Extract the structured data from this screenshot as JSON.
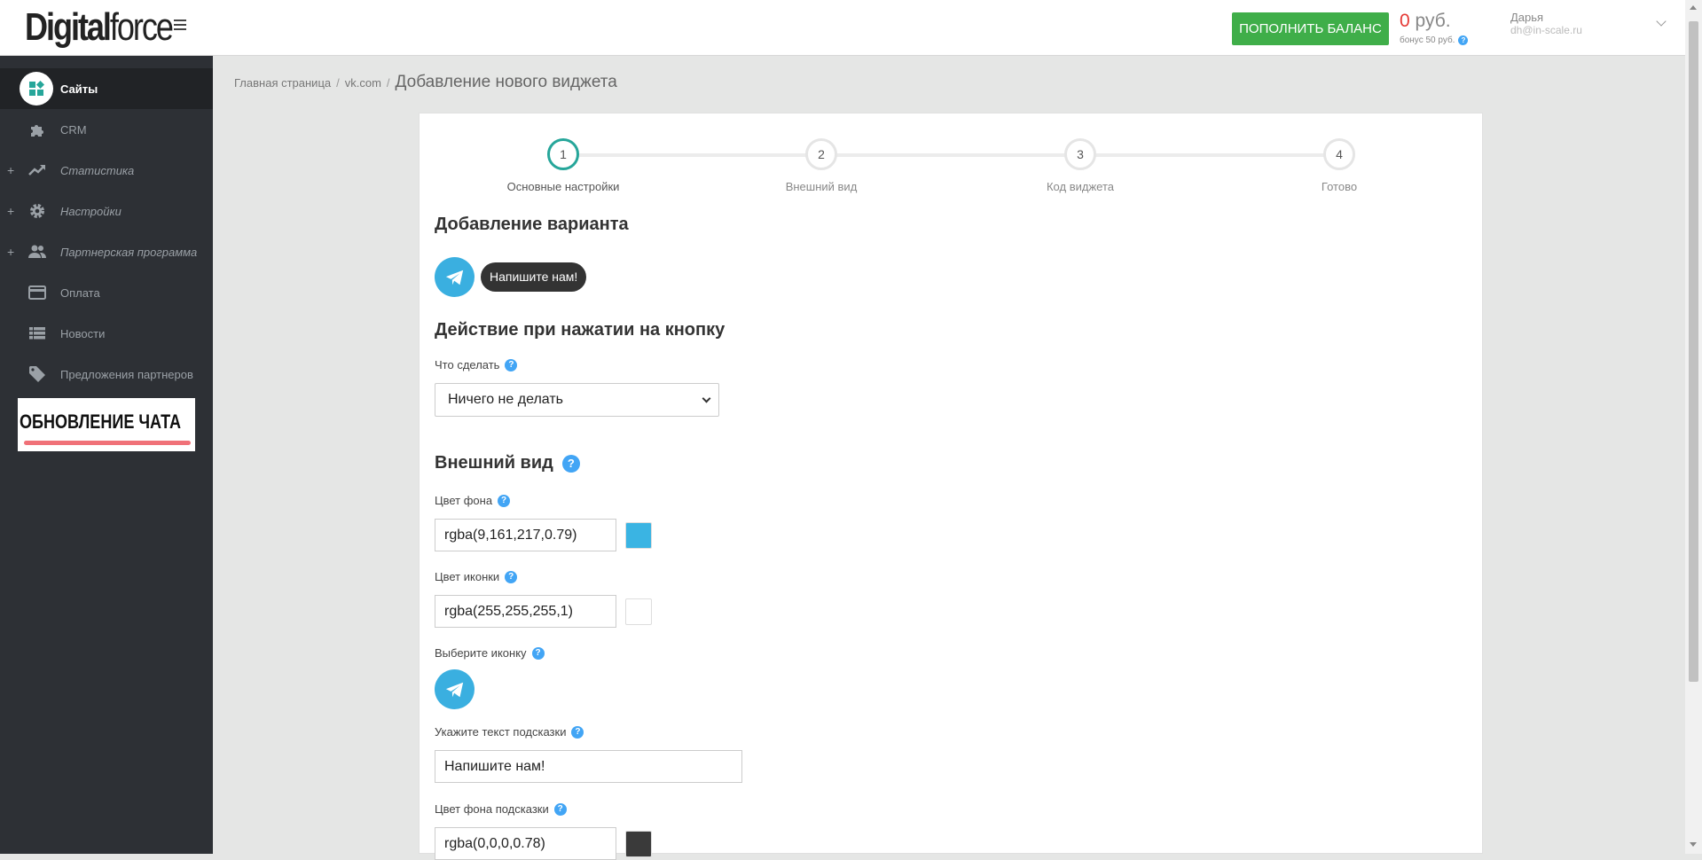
{
  "header": {
    "logo_bold": "Digital",
    "logo_rest": "force",
    "topup_label": "ПОПОЛНИТЬ БАЛАНС",
    "balance_amount": "0",
    "balance_currency": "руб.",
    "bonus_text": "бонус 50 руб.",
    "bonus_help": "?",
    "user_name": "Дарья",
    "user_email": "dh@in-scale.ru"
  },
  "sidebar": {
    "items": [
      {
        "label": "Сайты",
        "icon": "sites-icon",
        "expandable": false
      },
      {
        "label": "CRM",
        "icon": "crm-puzzle-icon",
        "expandable": false
      },
      {
        "label": "Статистика",
        "icon": "trending-up-icon",
        "expandable": true
      },
      {
        "label": "Настройки",
        "icon": "gear-icon",
        "expandable": true
      },
      {
        "label": "Партнерская программа",
        "icon": "people-icon",
        "expandable": true
      },
      {
        "label": "Оплата",
        "icon": "credit-card-icon",
        "expandable": false
      },
      {
        "label": "Новости",
        "icon": "list-icon",
        "expandable": false
      },
      {
        "label": "Предложения партнеров",
        "icon": "tag-icon",
        "expandable": false
      }
    ],
    "expand_symbol": "+",
    "promo_text": "ОБНОВЛЕНИЕ ЧАТА"
  },
  "breadcrumb": {
    "home": "Главная страница",
    "site": "vk.com",
    "current": "Добавление нового виджета",
    "separator": "/"
  },
  "stepper": {
    "steps": [
      {
        "num": "1",
        "label": "Основные настройки",
        "active": true
      },
      {
        "num": "2",
        "label": "Внешний вид",
        "active": false
      },
      {
        "num": "3",
        "label": "Код виджета",
        "active": false
      },
      {
        "num": "4",
        "label": "Готово",
        "active": false
      }
    ],
    "active_color": "#26a69a"
  },
  "form": {
    "variant_title": "Добавление варианта",
    "preview_tooltip": "Напишите нам!",
    "action_title": "Действие при нажатии на кнопку",
    "action_label": "Что сделать",
    "action_value": "Ничего не делать",
    "appearance_title": "Внешний вид",
    "bg_color_label": "Цвет фона",
    "bg_color_value": "rgba(9,161,217,0.79)",
    "icon_color_label": "Цвет иконки",
    "icon_color_value": "rgba(255,255,255,1)",
    "choose_icon_label": "Выберите иконку",
    "hint_text_label": "Укажите текст подсказки",
    "hint_text_value": "Напишите нам!",
    "hint_bg_label": "Цвет фона подсказки",
    "hint_bg_value": "rgba(0,0,0,0.78)",
    "help_symbol": "?"
  },
  "colors": {
    "brand_green": "#3fae49",
    "sidebar_bg": "#2d3035",
    "telegram_blue": "#3aafe0",
    "help_blue": "#42a5f5",
    "balance_red": "#e53935",
    "swatch_bg": "#3ab4e3",
    "swatch_icon": "#ffffff",
    "swatch_hint": "#3a3a3a"
  }
}
